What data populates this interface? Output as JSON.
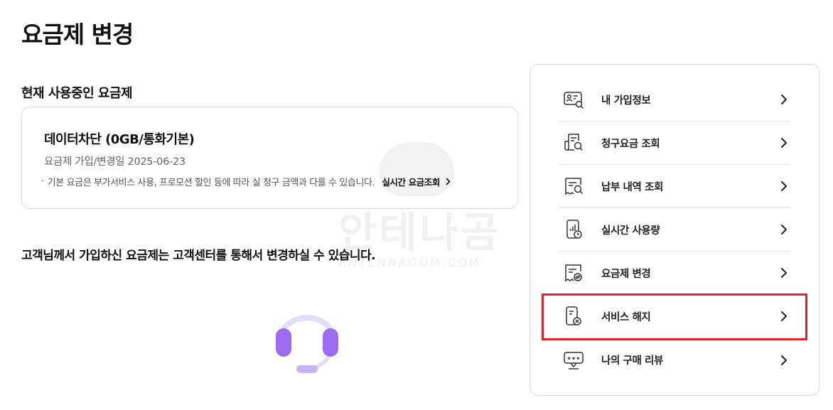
{
  "page_title": "요금제 변경",
  "current_plan": {
    "section_title": "현재 사용중인 요금제",
    "plan_name": "데이터차단 (0GB/통화기본)",
    "join_date": "요금제 가입/변경일 2025-06-23",
    "note": "기본 요금은 부가서비스 사용, 프로모션 할인 등에 따라 실 청구 금액과 다를 수 있습니다.",
    "realtime_link_label": "실시간 요금조회"
  },
  "notice_text": "고객님께서 가입하신 요금제는 고객센터를 통해서 변경하실 수 있습니다.",
  "watermark": {
    "korean": "안테나곰",
    "english": "ANTENNAGOM.COM"
  },
  "menu": {
    "items": [
      {
        "label": "내 가입정보",
        "icon": "member-info-icon"
      },
      {
        "label": "청구요금 조회",
        "icon": "bill-search-icon"
      },
      {
        "label": "납부 내역 조회",
        "icon": "payment-history-icon"
      },
      {
        "label": "실시간 사용량",
        "icon": "realtime-usage-icon"
      },
      {
        "label": "요금제 변경",
        "icon": "plan-change-icon"
      },
      {
        "label": "서비스 해지",
        "icon": "service-cancel-icon"
      },
      {
        "label": "나의 구매 리뷰",
        "icon": "review-icon"
      }
    ]
  },
  "colors": {
    "highlight": "#e0202a",
    "headset_purple": "#9b6cf0",
    "headset_light": "#dcd6f7"
  }
}
